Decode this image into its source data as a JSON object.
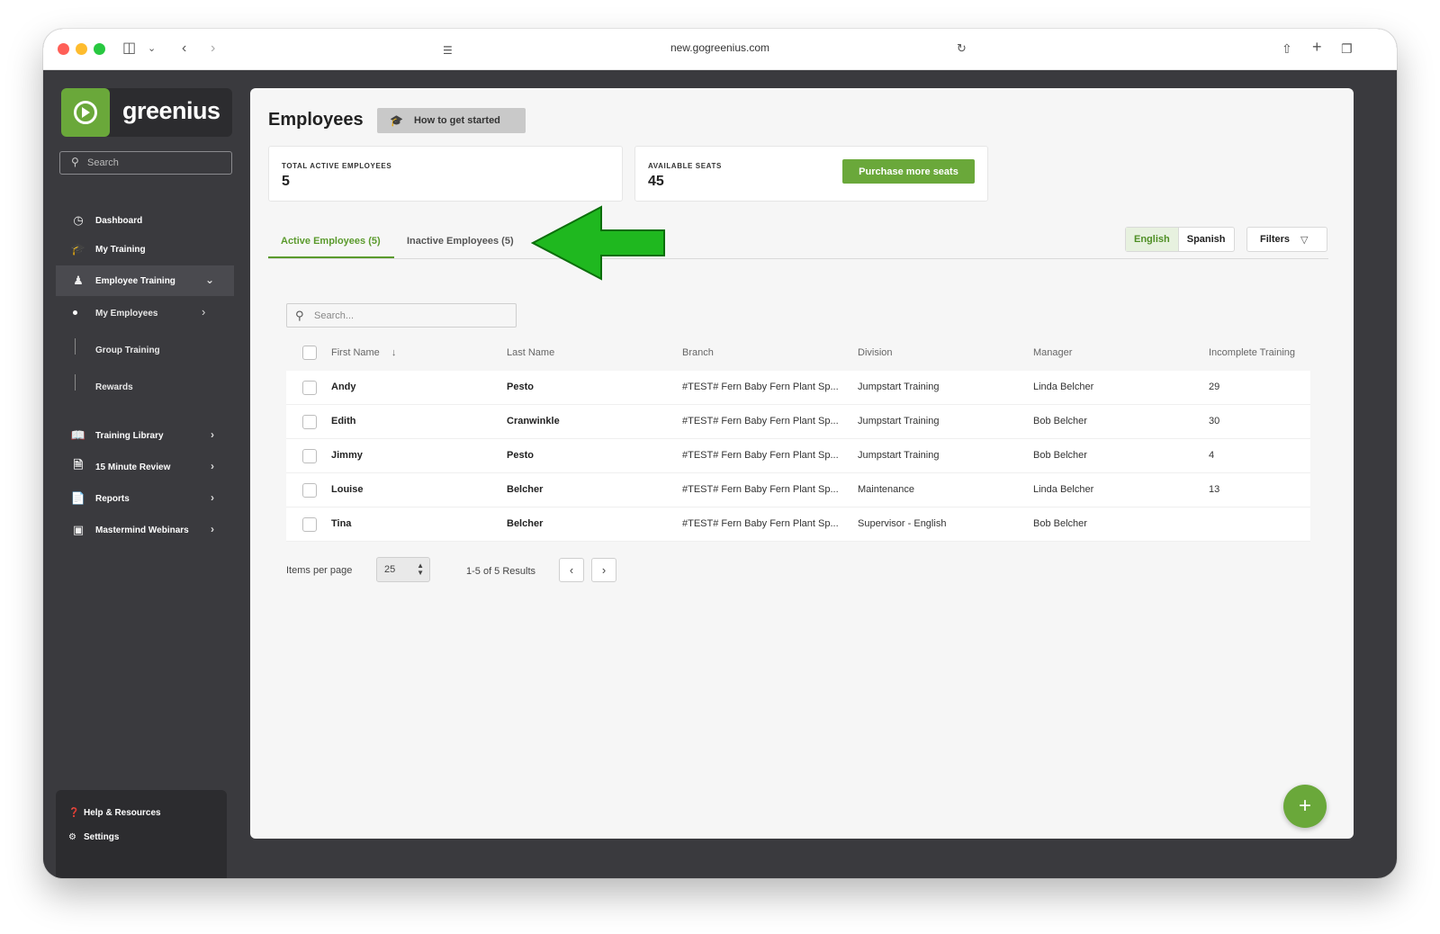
{
  "browser": {
    "url": "new.gogreenius.com",
    "icons": [
      "sidebar-toggle-icon",
      "chevron-down-icon",
      "back-icon",
      "forward-icon",
      "page-menu-icon",
      "reload-icon",
      "share-icon",
      "new-tab-icon",
      "tabs-overview-icon"
    ]
  },
  "sidebar": {
    "brand": "greenius",
    "search_placeholder": "Search",
    "items": [
      {
        "label": "Dashboard",
        "icon": "dashboard-icon"
      },
      {
        "label": "My Training",
        "icon": "graduation-cap-icon"
      },
      {
        "label": "Employee Training",
        "icon": "users-icon",
        "expanded": true
      },
      {
        "label": "Training Library",
        "icon": "book-icon"
      },
      {
        "label": "15 Minute Review",
        "icon": "document-icon"
      },
      {
        "label": "Reports",
        "icon": "report-icon"
      },
      {
        "label": "Mastermind Webinars",
        "icon": "video-icon"
      }
    ],
    "sub_items": [
      {
        "label": "My Employees"
      },
      {
        "label": "Group Training"
      },
      {
        "label": "Rewards"
      }
    ],
    "bottom": [
      {
        "label": "Help & Resources",
        "icon": "help-icon"
      },
      {
        "label": "Settings",
        "icon": "gear-icon"
      }
    ]
  },
  "main": {
    "title": "Employees",
    "howto_label": "How to get started",
    "cards": {
      "total_label": "TOTAL ACTIVE EMPLOYEES",
      "total_value": "5",
      "seats_label": "AVAILABLE SEATS",
      "seats_value": "45",
      "purchase_label": "Purchase more seats"
    },
    "tabs": [
      {
        "label": "Active Employees (5)",
        "active": true
      },
      {
        "label": "Inactive Employees (5)",
        "active": false
      }
    ],
    "languages": [
      {
        "label": "English",
        "selected": true
      },
      {
        "label": "Spanish",
        "selected": false
      }
    ],
    "filters_label": "Filters",
    "search_placeholder": "Search...",
    "columns": [
      "First Name",
      "Last Name",
      "Branch",
      "Division",
      "Manager",
      "Incomplete Training"
    ],
    "rows": [
      {
        "first": "Andy",
        "last": "Pesto",
        "branch": "#TEST# Fern Baby Fern Plant Sp...",
        "division": "Jumpstart Training",
        "manager": "Linda Belcher",
        "incomplete": "29"
      },
      {
        "first": "Edith",
        "last": "Cranwinkle",
        "branch": "#TEST# Fern Baby Fern Plant Sp...",
        "division": "Jumpstart Training",
        "manager": "Bob Belcher",
        "incomplete": "30"
      },
      {
        "first": "Jimmy",
        "last": "Pesto",
        "branch": "#TEST# Fern Baby Fern Plant Sp...",
        "division": "Jumpstart Training",
        "manager": "Bob Belcher",
        "incomplete": "4"
      },
      {
        "first": "Louise",
        "last": "Belcher",
        "branch": "#TEST# Fern Baby Fern Plant Sp...",
        "division": "Maintenance",
        "manager": "Linda Belcher",
        "incomplete": "13"
      },
      {
        "first": "Tina",
        "last": "Belcher",
        "branch": "#TEST# Fern Baby Fern Plant Sp...",
        "division": "Supervisor - English",
        "manager": "Bob Belcher",
        "incomplete": ""
      }
    ],
    "pager": {
      "items_per_page_label": "Items per page",
      "items_per_page_value": "25",
      "results": "1-5 of 5 Results"
    },
    "fab_label": "+"
  },
  "colors": {
    "brand_green": "#6aa83a",
    "sidebar_bg": "#3a3a3e",
    "annotation_arrow": "#1fb81f"
  }
}
